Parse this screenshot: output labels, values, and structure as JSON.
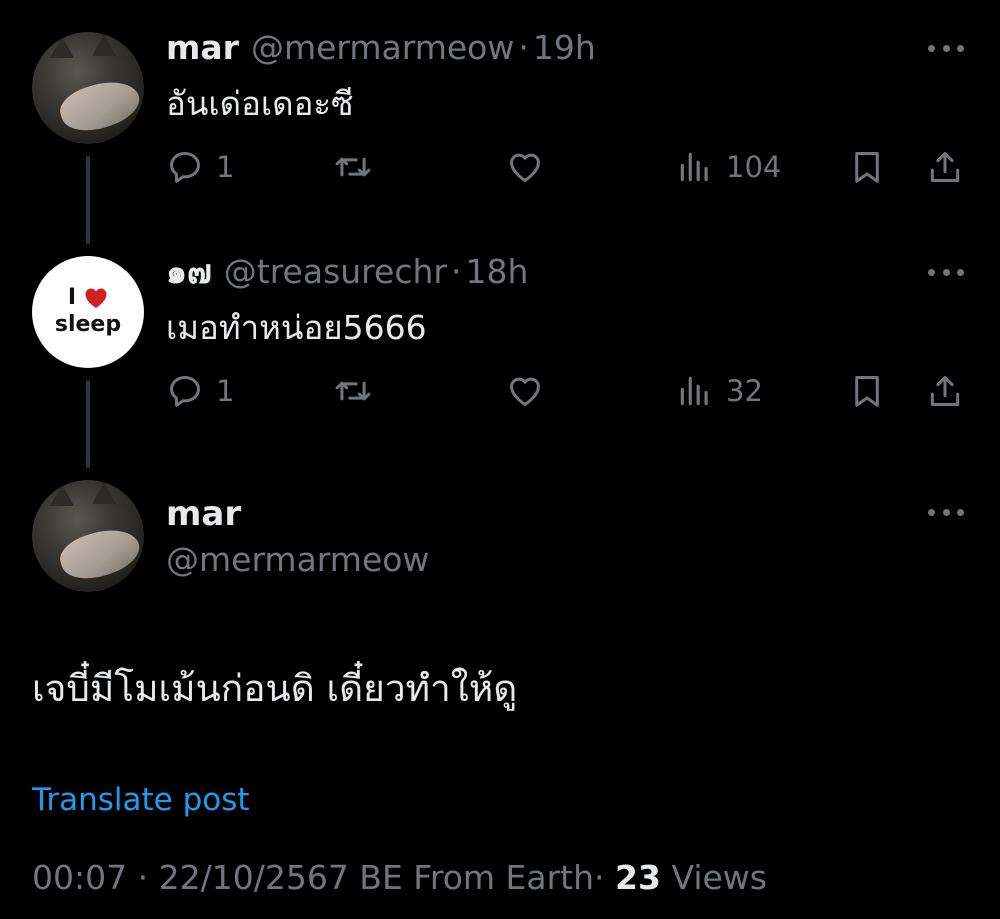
{
  "tweets": [
    {
      "name": "mar",
      "handle": "@mermarmeow",
      "separator": "·",
      "time": "19h",
      "text": "อันเด่อเดอะซี",
      "replies": "1",
      "retweets": "",
      "likes": "",
      "views": "104"
    },
    {
      "name": "๑๗",
      "handle": "@treasurechr",
      "separator": "·",
      "time": "18h",
      "text": "เมอทำหน่อย5666",
      "replies": "1",
      "retweets": "",
      "likes": "",
      "views": "32",
      "avatar": {
        "line1": "I",
        "line2": "sleep",
        "heart_color": "#d0202a"
      }
    }
  ],
  "main_post": {
    "name": "mar",
    "handle": "@mermarmeow",
    "text": "เจบี๋มีโมเม้นก่อนดิ เดี๋ยวทำให้ดู",
    "translate_label": "Translate post",
    "meta": {
      "time": "00:07",
      "separator": "·",
      "date": "22/10/2567 BE",
      "source": "From Earth",
      "separator2": "·",
      "views_count": "23",
      "views_label": "Views"
    }
  },
  "icons": {
    "reply": "reply-icon",
    "retweet": "retweet-icon",
    "like": "heart-icon",
    "views": "analytics-icon",
    "bookmark": "bookmark-icon",
    "share": "share-icon",
    "more": "more-icon"
  },
  "colors": {
    "background": "#000000",
    "text_primary": "#e7e9ea",
    "text_secondary": "#71767b",
    "link": "#1d9bf0",
    "thread_line": "#333639"
  }
}
